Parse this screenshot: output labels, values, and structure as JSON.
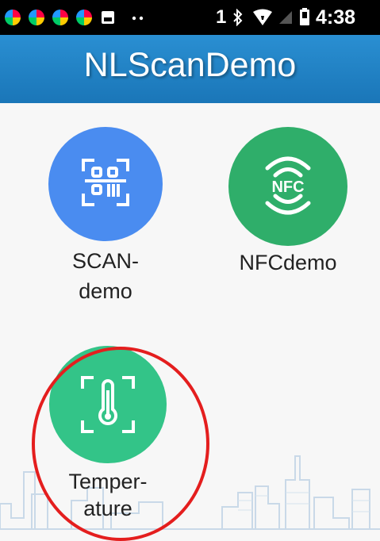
{
  "status_bar": {
    "sim_slot": "1",
    "time": "4:38",
    "icons": [
      "app-notification-icon",
      "app-notification-icon",
      "app-notification-icon",
      "app-notification-icon",
      "image-notification-icon",
      "more-icon",
      "bluetooth-icon",
      "wifi-icon",
      "no-sim-icon",
      "battery-icon"
    ]
  },
  "app_bar": {
    "title": "NLScanDemo"
  },
  "tiles": [
    {
      "label_line1": "SCAN-",
      "label_line2": "demo",
      "icon": "scan-icon",
      "color": "#4a8cf0"
    },
    {
      "label_line1": "NFCdemo",
      "label_line2": "",
      "icon": "nfc-icon",
      "color": "#2fae6a",
      "badge": "NFC"
    },
    {
      "label_line1": "Temper-",
      "label_line2": "ature",
      "icon": "thermometer-icon",
      "color": "#33c488"
    }
  ],
  "colors": {
    "app_bar": "#1a7fc4",
    "annotation_ring": "#e41e1e"
  }
}
